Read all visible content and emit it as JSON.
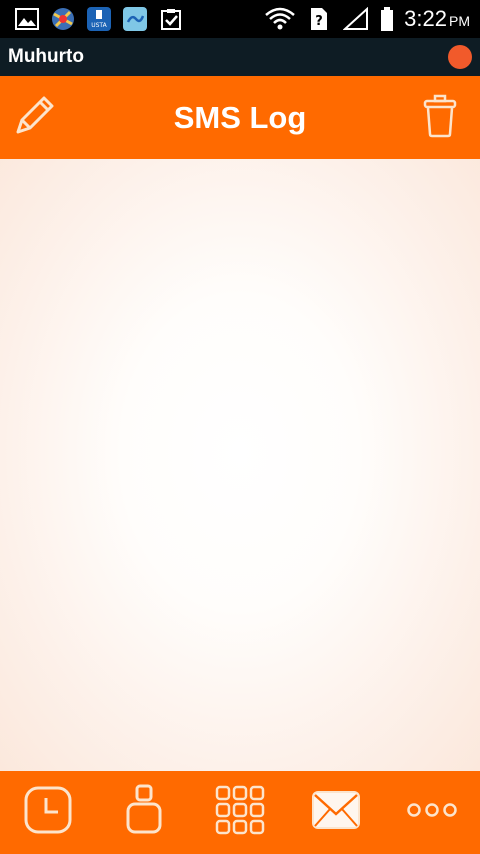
{
  "status_bar": {
    "time": "3:22",
    "ampm": "PM",
    "left_icons": [
      "gallery-icon",
      "app-icon",
      "usb-storage-icon",
      "link-app-icon",
      "clipboard-check-icon"
    ],
    "right_icons": [
      "wifi-icon",
      "sim-unknown-icon",
      "signal-icon",
      "battery-icon"
    ]
  },
  "app_bar": {
    "title": "Muhurto",
    "accent_color": "#f15a2b"
  },
  "header": {
    "title": "SMS Log",
    "left_icon": "pencil-icon",
    "right_icon": "trash-icon",
    "color": "#ff6a00"
  },
  "bottom_nav": {
    "items": [
      {
        "icon": "clock-icon",
        "name": "history"
      },
      {
        "icon": "contact-icon",
        "name": "contacts"
      },
      {
        "icon": "dialpad-icon",
        "name": "dialpad"
      },
      {
        "icon": "envelope-icon",
        "name": "messages"
      },
      {
        "icon": "more-icon",
        "name": "more"
      }
    ]
  }
}
